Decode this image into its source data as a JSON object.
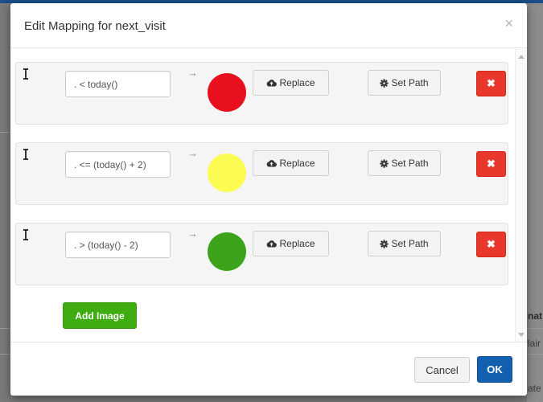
{
  "dialog": {
    "title": "Edit Mapping for next_visit",
    "close_glyph": "×"
  },
  "mappings": [
    {
      "expression": ". < today()",
      "color_name": "red",
      "color": "#e8101e"
    },
    {
      "expression": ". <= (today() + 2)",
      "color_name": "yellow",
      "color": "#fbfb52"
    },
    {
      "expression": ". > (today() - 2)",
      "color_name": "green",
      "color": "#3da31b"
    }
  ],
  "row_actions": {
    "arrow_glyph": "→",
    "replace_label": "Replace",
    "replace_icon": "cloud-upload-icon",
    "set_path_label": "Set Path",
    "set_path_icon": "gear-icon",
    "remove_glyph": "✖",
    "drag_icon": "drag-handle-icon"
  },
  "add_image_label": "Add Image",
  "footer": {
    "cancel_label": "Cancel",
    "ok_label": "OK"
  },
  "background_fragments": [
    "nat",
    "lair",
    "ate"
  ],
  "colors": {
    "danger": "#e8382c",
    "success": "#3fad12",
    "primary": "#1460b0"
  }
}
